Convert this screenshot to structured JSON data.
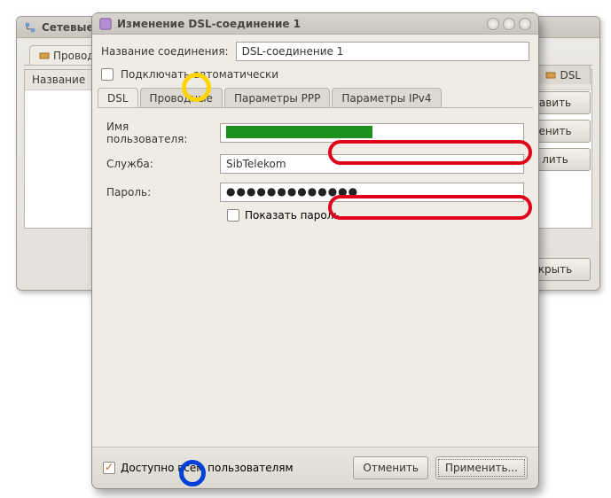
{
  "back": {
    "title": "Сетевые",
    "tabs": {
      "wired": "Провод",
      "dsl": "DSL"
    },
    "list_header": "Название",
    "buttons": {
      "add": "авить",
      "edit": "енить",
      "remove": "лить",
      "close": "крыть"
    }
  },
  "modal": {
    "title": "Изменение DSL-соединение 1",
    "conn_name_label": "Название соединения:",
    "conn_name_value": "DSL-соединение 1",
    "autoconnect_label": "Подключать автоматически",
    "tabs": {
      "dsl": "DSL",
      "wired": "Проводные",
      "ppp": "Параметры PPP",
      "ipv4": "Параметры IPv4"
    },
    "form": {
      "username_label": "Имя пользователя:",
      "service_label": "Служба:",
      "service_value": "SibTelekom",
      "password_label": "Пароль:",
      "show_password_label": "Показать пароль"
    },
    "footer": {
      "available_all_label": "Доступно всем пользователям",
      "cancel": "Отменить",
      "apply": "Применить..."
    }
  }
}
